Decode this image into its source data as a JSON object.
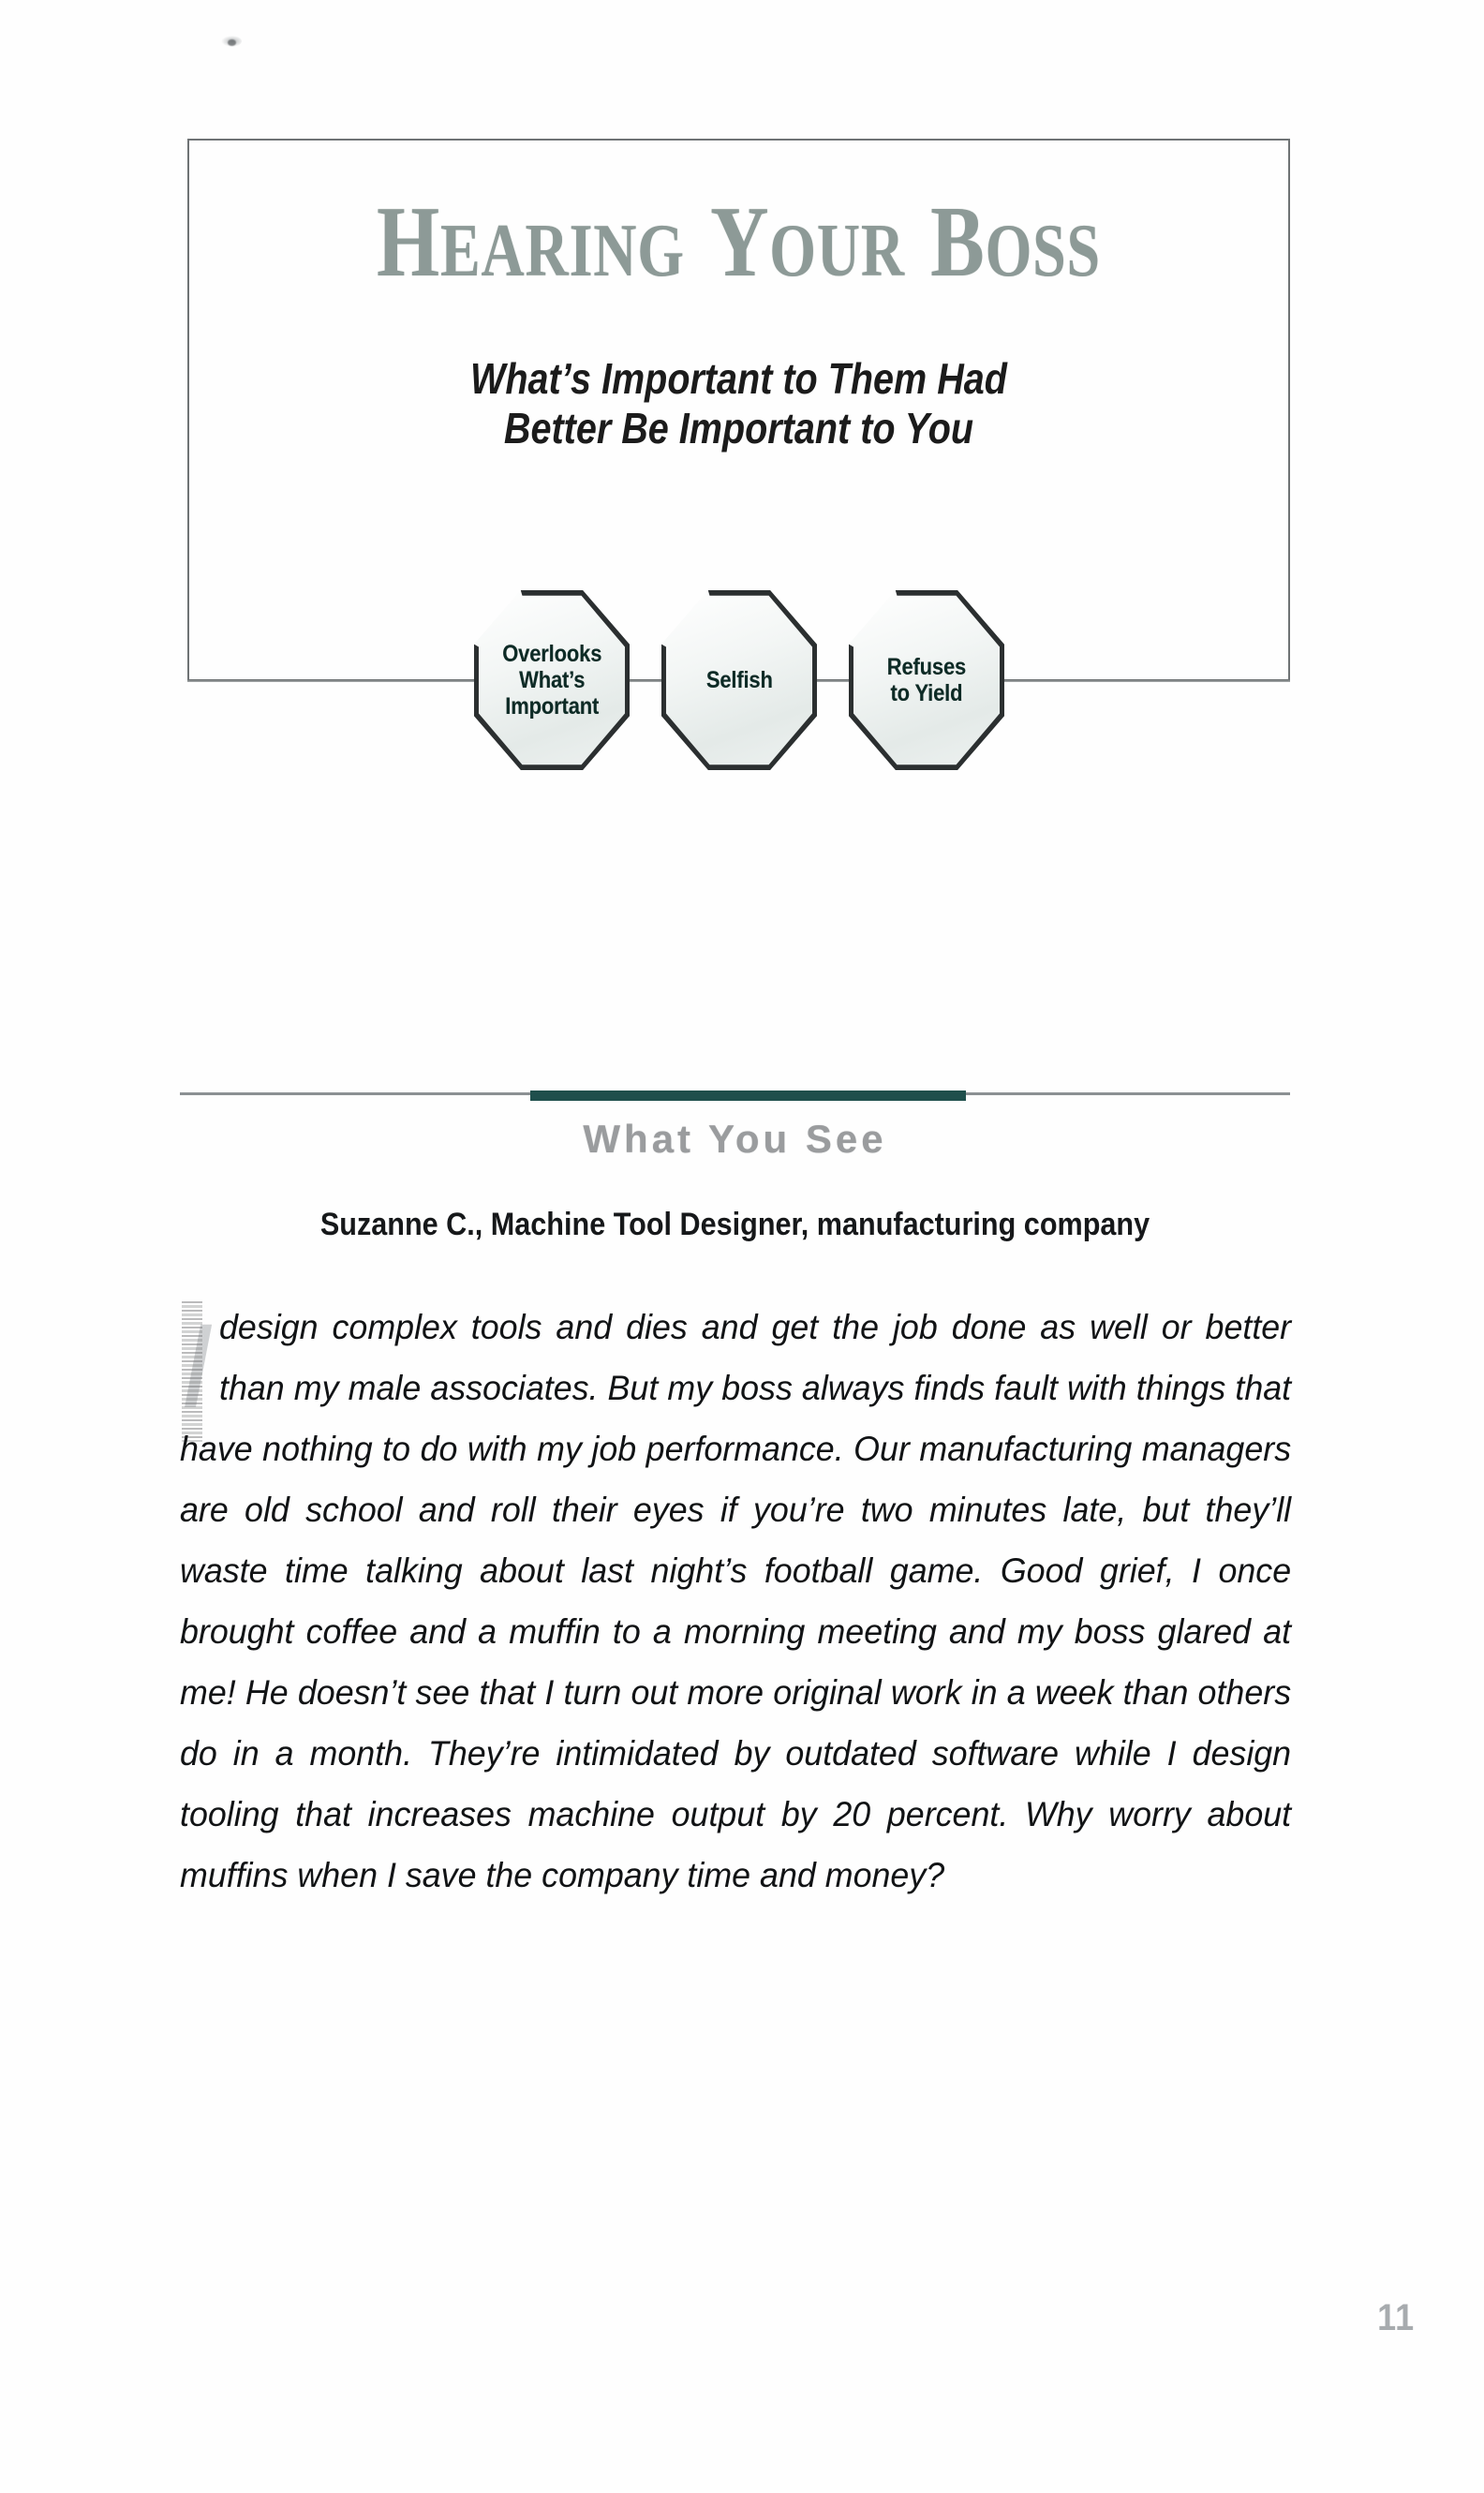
{
  "page": {
    "number": "11",
    "background_color": "#fefefe"
  },
  "chapter": {
    "title_main": "EARING",
    "title_lead_cap": "H",
    "title_word2_cap": "Y",
    "title_word2": "OUR",
    "title_word3_cap": "B",
    "title_word3": "OSS",
    "title_plain": "HEARING YOUR BOSS",
    "title_color": "#8d9a97",
    "subtitle_line1": "What’s Important to Them Had",
    "subtitle_line2": "Better Be Important to You"
  },
  "badges": {
    "connector_color": "#8b8f91",
    "items": [
      {
        "label_line1": "Overlooks",
        "label_line2": "What’s",
        "label_line3": "Important"
      },
      {
        "label_line1": "Selfish",
        "label_line2": "",
        "label_line3": ""
      },
      {
        "label_line1": "Refuses",
        "label_line2": "to Yield",
        "label_line3": ""
      }
    ]
  },
  "section": {
    "heading": "What You See",
    "heading_color": "#9a9c9e",
    "rule_accent_color": "#1f4f4c",
    "rule_color": "#8b9093"
  },
  "testimonial": {
    "byline": "Suzanne C., Machine Tool Designer, manufacturing company",
    "drop_cap": "I",
    "body": "design complex tools and dies and get the job done as well or better than my male associates. But my boss always finds fault with things that have nothing to do with my job performance. Our manufacturing managers are old school and roll their eyes if you’re two minutes late, but they’ll waste time talking about last night’s football game. Good grief, I once brought coffee and a muffin to a morning meeting and my boss glared at me! He doesn’t see that I turn out more original work in a week than others do in a month. They’re intimidated by outdated software while I design tooling that increases machine output by 20 percent. Why worry about muffins when I save the company time and money?"
  }
}
